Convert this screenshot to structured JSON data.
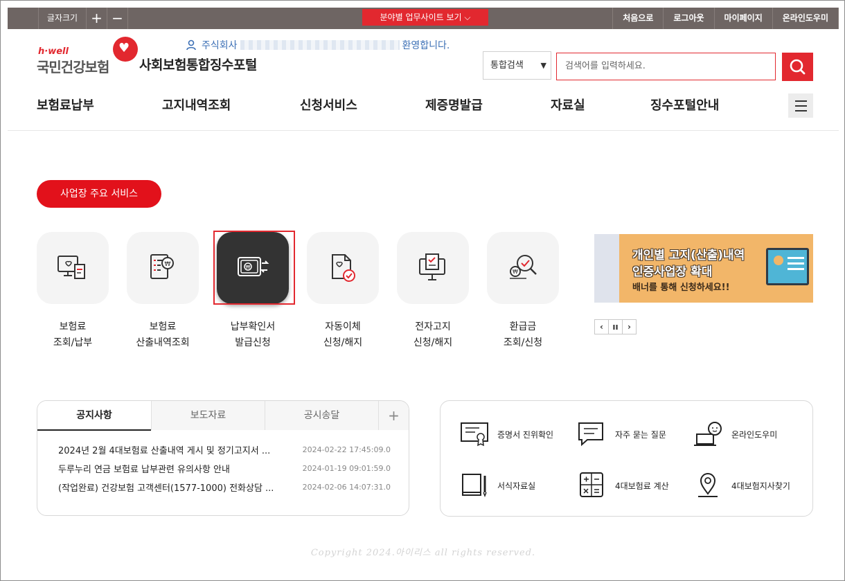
{
  "topbar": {
    "font_size_label": "글자크기",
    "increase": "+",
    "decrease": "−",
    "field_site": "분야별 업무사이트 보기 ⌵",
    "utils": [
      "처음으로",
      "로그아웃",
      "마이페이지",
      "온라인도우미"
    ]
  },
  "header": {
    "logo_small": "h·well",
    "logo_main": "국민건강보험",
    "portal_title": "사회보험통합징수포털",
    "welcome_prefix": "주식회사",
    "welcome_suffix": "환영합니다."
  },
  "search": {
    "scope": "통합검색",
    "placeholder": "검색어를 입력하세요."
  },
  "nav": [
    "보험료납부",
    "고지내역조회",
    "신청서비스",
    "제증명발급",
    "자료실",
    "징수포털안내"
  ],
  "services": {
    "title": "사업장 주요 서비스",
    "items": [
      {
        "line1": "보험료",
        "line2": "조회/납부",
        "icon": "monitor-receipt-icon"
      },
      {
        "line1": "보험료",
        "line2": "산출내역조회",
        "icon": "document-won-icon"
      },
      {
        "line1": "납부확인서",
        "line2": "발급신청",
        "icon": "payment-card-icon"
      },
      {
        "line1": "자동이체",
        "line2": "신청/해지",
        "icon": "document-check-icon"
      },
      {
        "line1": "전자고지",
        "line2": "신청/해지",
        "icon": "monitor-check-icon"
      },
      {
        "line1": "환급금",
        "line2": "조회/신청",
        "icon": "magnifier-won-icon"
      }
    ]
  },
  "banner": {
    "line1": "개인별 고지(산출)내역",
    "line2": "인증사업장 확대",
    "line3": "배너를 통해 신청하세요!!",
    "controls": [
      "‹",
      "ıı",
      "›"
    ]
  },
  "notice": {
    "tabs": [
      "공지사항",
      "보도자료",
      "공시송달",
      "+"
    ],
    "items": [
      {
        "title": "2024년 2월 4대보험료 산출내역 게시 및 정기고지서 ...",
        "date": "2024-02-22 17:45:09.0"
      },
      {
        "title": "두루누리 연금 보험료 납부관련 유의사항 안내",
        "date": "2024-01-19 09:01:59.0"
      },
      {
        "title": "(작업완료) 건강보험 고객센터(1577-1000) 전화상담 ...",
        "date": "2024-02-06 14:07:31.0"
      }
    ]
  },
  "quick_links": [
    {
      "label": "증명서 진위확인",
      "icon": "certificate-icon"
    },
    {
      "label": "자주 묻는 질문",
      "icon": "chat-bubble-icon"
    },
    {
      "label": "온라인도우미",
      "icon": "helper-icon"
    },
    {
      "label": "서식자료실",
      "icon": "book-pen-icon"
    },
    {
      "label": "4대보험료 계산",
      "icon": "calculator-icon"
    },
    {
      "label": "4대보험지사찾기",
      "icon": "map-pin-icon"
    }
  ],
  "copyright": "Copyright 2024.아이리스 all rights reserved.",
  "colors": {
    "accent": "#e2282f",
    "topbar": "#6e6563",
    "active_tile": "#333333"
  }
}
